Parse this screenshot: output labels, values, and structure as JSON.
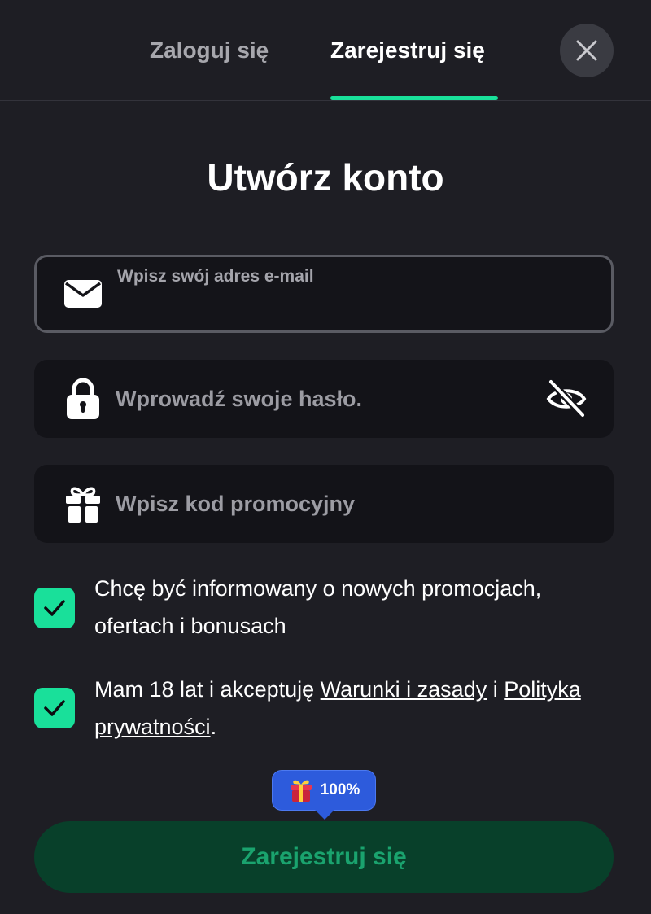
{
  "tabs": {
    "login": "Zaloguj się",
    "register": "Zarejestruj się"
  },
  "title": "Utwórz konto",
  "email": {
    "label": "Wpisz swój adres e-mail",
    "value": "",
    "icon": "envelope-icon"
  },
  "password": {
    "placeholder": "Wprowadź swoje hasło.",
    "icon": "lock-icon",
    "toggle_icon": "eye-slash-icon"
  },
  "promo": {
    "placeholder": "Wpisz kod promocyjny",
    "icon": "gift-icon"
  },
  "consents": {
    "newsletter": {
      "text": "Chcę być informowany o nowych promocjach, ofertach i bonusach",
      "checked": true
    },
    "terms": {
      "prefix": "Mam 18 lat i akceptuję ",
      "terms_link": "Warunki i zasady",
      "middle": " i ",
      "privacy_link": "Polityka prywatności",
      "suffix": ".",
      "checked": true
    }
  },
  "bonus_badge": {
    "value": "100%",
    "icon": "gift-box-icon"
  },
  "submit": {
    "label": "Zarejestruj się"
  },
  "colors": {
    "background": "#1e1e24",
    "accent": "#19e09a",
    "badge": "#2d5bdc",
    "submit_bg": "#08402a",
    "submit_text": "#1aa36e"
  }
}
